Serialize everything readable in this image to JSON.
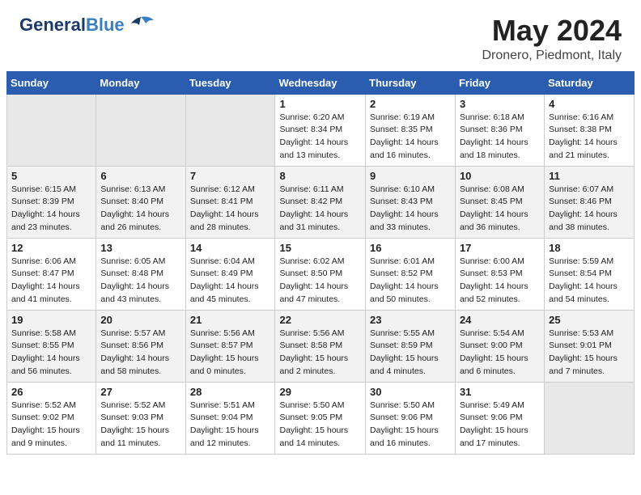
{
  "header": {
    "logo_general": "General",
    "logo_blue": "Blue",
    "month_title": "May 2024",
    "location": "Dronero, Piedmont, Italy"
  },
  "weekdays": [
    "Sunday",
    "Monday",
    "Tuesday",
    "Wednesday",
    "Thursday",
    "Friday",
    "Saturday"
  ],
  "weeks": [
    [
      {
        "day": "",
        "empty": true
      },
      {
        "day": "",
        "empty": true
      },
      {
        "day": "",
        "empty": true
      },
      {
        "day": "1",
        "sunrise": "Sunrise: 6:20 AM",
        "sunset": "Sunset: 8:34 PM",
        "daylight": "Daylight: 14 hours and 13 minutes."
      },
      {
        "day": "2",
        "sunrise": "Sunrise: 6:19 AM",
        "sunset": "Sunset: 8:35 PM",
        "daylight": "Daylight: 14 hours and 16 minutes."
      },
      {
        "day": "3",
        "sunrise": "Sunrise: 6:18 AM",
        "sunset": "Sunset: 8:36 PM",
        "daylight": "Daylight: 14 hours and 18 minutes."
      },
      {
        "day": "4",
        "sunrise": "Sunrise: 6:16 AM",
        "sunset": "Sunset: 8:38 PM",
        "daylight": "Daylight: 14 hours and 21 minutes."
      }
    ],
    [
      {
        "day": "5",
        "sunrise": "Sunrise: 6:15 AM",
        "sunset": "Sunset: 8:39 PM",
        "daylight": "Daylight: 14 hours and 23 minutes."
      },
      {
        "day": "6",
        "sunrise": "Sunrise: 6:13 AM",
        "sunset": "Sunset: 8:40 PM",
        "daylight": "Daylight: 14 hours and 26 minutes."
      },
      {
        "day": "7",
        "sunrise": "Sunrise: 6:12 AM",
        "sunset": "Sunset: 8:41 PM",
        "daylight": "Daylight: 14 hours and 28 minutes."
      },
      {
        "day": "8",
        "sunrise": "Sunrise: 6:11 AM",
        "sunset": "Sunset: 8:42 PM",
        "daylight": "Daylight: 14 hours and 31 minutes."
      },
      {
        "day": "9",
        "sunrise": "Sunrise: 6:10 AM",
        "sunset": "Sunset: 8:43 PM",
        "daylight": "Daylight: 14 hours and 33 minutes."
      },
      {
        "day": "10",
        "sunrise": "Sunrise: 6:08 AM",
        "sunset": "Sunset: 8:45 PM",
        "daylight": "Daylight: 14 hours and 36 minutes."
      },
      {
        "day": "11",
        "sunrise": "Sunrise: 6:07 AM",
        "sunset": "Sunset: 8:46 PM",
        "daylight": "Daylight: 14 hours and 38 minutes."
      }
    ],
    [
      {
        "day": "12",
        "sunrise": "Sunrise: 6:06 AM",
        "sunset": "Sunset: 8:47 PM",
        "daylight": "Daylight: 14 hours and 41 minutes."
      },
      {
        "day": "13",
        "sunrise": "Sunrise: 6:05 AM",
        "sunset": "Sunset: 8:48 PM",
        "daylight": "Daylight: 14 hours and 43 minutes."
      },
      {
        "day": "14",
        "sunrise": "Sunrise: 6:04 AM",
        "sunset": "Sunset: 8:49 PM",
        "daylight": "Daylight: 14 hours and 45 minutes."
      },
      {
        "day": "15",
        "sunrise": "Sunrise: 6:02 AM",
        "sunset": "Sunset: 8:50 PM",
        "daylight": "Daylight: 14 hours and 47 minutes."
      },
      {
        "day": "16",
        "sunrise": "Sunrise: 6:01 AM",
        "sunset": "Sunset: 8:52 PM",
        "daylight": "Daylight: 14 hours and 50 minutes."
      },
      {
        "day": "17",
        "sunrise": "Sunrise: 6:00 AM",
        "sunset": "Sunset: 8:53 PM",
        "daylight": "Daylight: 14 hours and 52 minutes."
      },
      {
        "day": "18",
        "sunrise": "Sunrise: 5:59 AM",
        "sunset": "Sunset: 8:54 PM",
        "daylight": "Daylight: 14 hours and 54 minutes."
      }
    ],
    [
      {
        "day": "19",
        "sunrise": "Sunrise: 5:58 AM",
        "sunset": "Sunset: 8:55 PM",
        "daylight": "Daylight: 14 hours and 56 minutes."
      },
      {
        "day": "20",
        "sunrise": "Sunrise: 5:57 AM",
        "sunset": "Sunset: 8:56 PM",
        "daylight": "Daylight: 14 hours and 58 minutes."
      },
      {
        "day": "21",
        "sunrise": "Sunrise: 5:56 AM",
        "sunset": "Sunset: 8:57 PM",
        "daylight": "Daylight: 15 hours and 0 minutes."
      },
      {
        "day": "22",
        "sunrise": "Sunrise: 5:56 AM",
        "sunset": "Sunset: 8:58 PM",
        "daylight": "Daylight: 15 hours and 2 minutes."
      },
      {
        "day": "23",
        "sunrise": "Sunrise: 5:55 AM",
        "sunset": "Sunset: 8:59 PM",
        "daylight": "Daylight: 15 hours and 4 minutes."
      },
      {
        "day": "24",
        "sunrise": "Sunrise: 5:54 AM",
        "sunset": "Sunset: 9:00 PM",
        "daylight": "Daylight: 15 hours and 6 minutes."
      },
      {
        "day": "25",
        "sunrise": "Sunrise: 5:53 AM",
        "sunset": "Sunset: 9:01 PM",
        "daylight": "Daylight: 15 hours and 7 minutes."
      }
    ],
    [
      {
        "day": "26",
        "sunrise": "Sunrise: 5:52 AM",
        "sunset": "Sunset: 9:02 PM",
        "daylight": "Daylight: 15 hours and 9 minutes."
      },
      {
        "day": "27",
        "sunrise": "Sunrise: 5:52 AM",
        "sunset": "Sunset: 9:03 PM",
        "daylight": "Daylight: 15 hours and 11 minutes."
      },
      {
        "day": "28",
        "sunrise": "Sunrise: 5:51 AM",
        "sunset": "Sunset: 9:04 PM",
        "daylight": "Daylight: 15 hours and 12 minutes."
      },
      {
        "day": "29",
        "sunrise": "Sunrise: 5:50 AM",
        "sunset": "Sunset: 9:05 PM",
        "daylight": "Daylight: 15 hours and 14 minutes."
      },
      {
        "day": "30",
        "sunrise": "Sunrise: 5:50 AM",
        "sunset": "Sunset: 9:06 PM",
        "daylight": "Daylight: 15 hours and 16 minutes."
      },
      {
        "day": "31",
        "sunrise": "Sunrise: 5:49 AM",
        "sunset": "Sunset: 9:06 PM",
        "daylight": "Daylight: 15 hours and 17 minutes."
      },
      {
        "day": "",
        "empty": true
      }
    ]
  ]
}
